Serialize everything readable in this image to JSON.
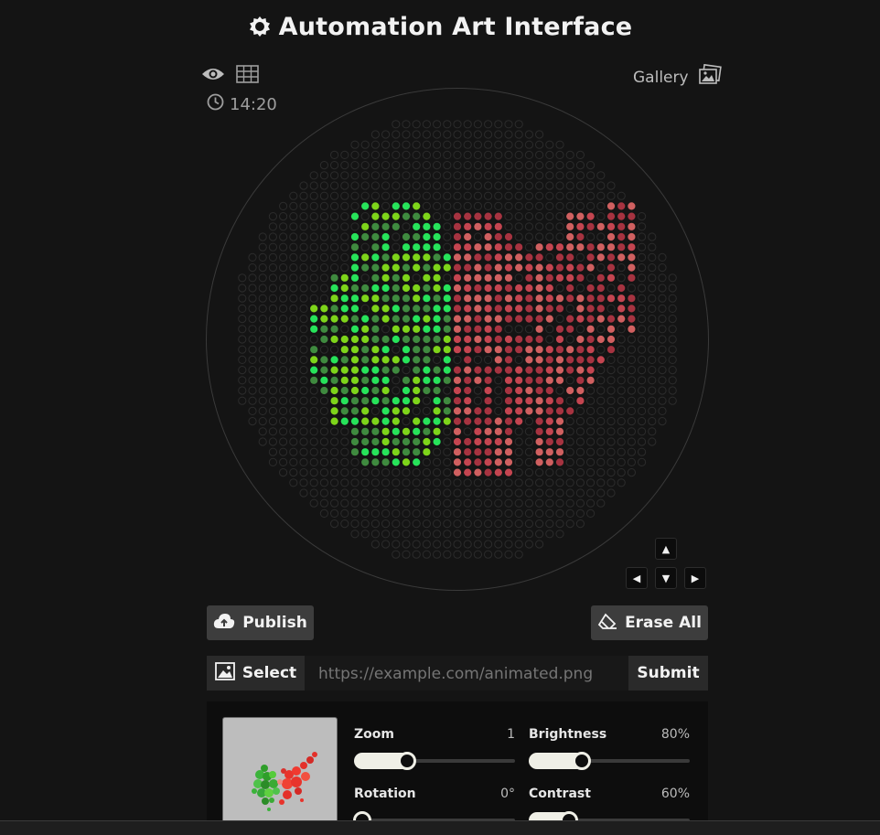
{
  "header": {
    "title": "Automation Art Interface",
    "time": "14:20",
    "gallery_label": "Gallery"
  },
  "icons": {
    "logo": "gear-icon",
    "view": "eye-icon",
    "grid": "grid-icon",
    "clock": "clock-icon",
    "gallery": "images-icon"
  },
  "actions": {
    "publish_label": "Publish",
    "erase_label": "Erase All"
  },
  "image_input": {
    "select_label": "Select",
    "url_placeholder": "https://example.com/animated.png",
    "submit_label": "Submit"
  },
  "controls": {
    "zoom": {
      "label": "Zoom",
      "value": "1",
      "level": 0.28
    },
    "brightness": {
      "label": "Brightness",
      "value": "80%",
      "level": 0.28
    },
    "rotation": {
      "label": "Rotation",
      "value": "0°",
      "level": 0.0
    },
    "contrast": {
      "label": "Contrast",
      "value": "60%",
      "level": 0.2
    }
  },
  "colors": {
    "background": "#141414",
    "empty_dot": "#2c2c2c",
    "green_a": "#27e35a",
    "green_b": "#7ed41a",
    "green_c": "#3f8a3f",
    "red_a": "#c44550",
    "red_b": "#a63340",
    "red_c": "#d06060"
  }
}
